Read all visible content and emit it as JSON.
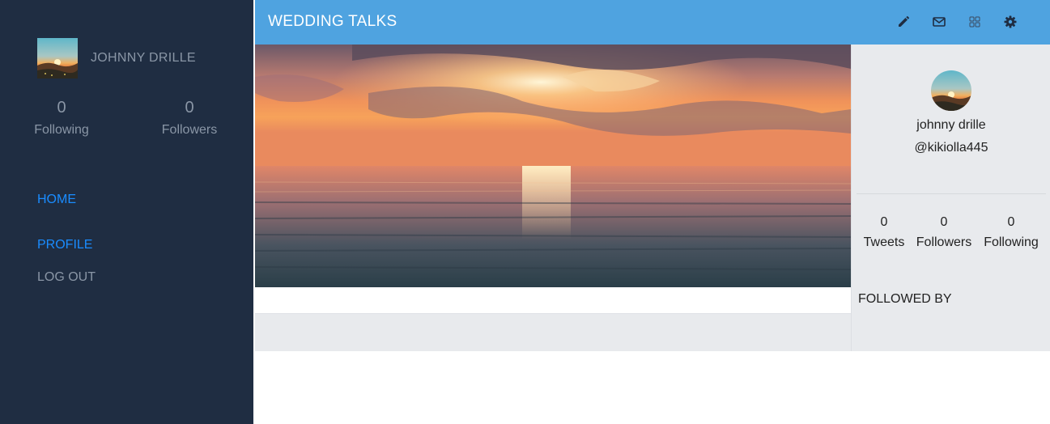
{
  "sidebar": {
    "user_name": "JOHNNY DRILLE",
    "avatar_icon": "sunset-avatar-image",
    "stats": [
      {
        "value": "0",
        "label": "Following"
      },
      {
        "value": "0",
        "label": "Followers"
      }
    ],
    "nav": {
      "home": "HOME",
      "profile": "PROFILE",
      "logout": "LOG OUT"
    }
  },
  "header": {
    "title": "WEDDING TALKS",
    "icons": [
      "pencil-icon",
      "envelope-icon",
      "grid-icon",
      "gear-icon"
    ]
  },
  "profile_card": {
    "display_name": "johnny drille",
    "handle": "@kikiolla445",
    "stats": [
      {
        "value": "0",
        "label": "Tweets"
      },
      {
        "value": "0",
        "label": "Followers"
      },
      {
        "value": "0",
        "label": "Following"
      }
    ],
    "followed_by_label": "FOLLOWED BY"
  },
  "cover": {
    "image": "ocean-sunset-cover-image"
  },
  "colors": {
    "sidebar_bg": "#1f2d42",
    "header_bg": "#4fa3e0",
    "link_active": "#1a8cff",
    "muted_text": "#8a96a6",
    "panel_bg": "#e8eaed"
  }
}
